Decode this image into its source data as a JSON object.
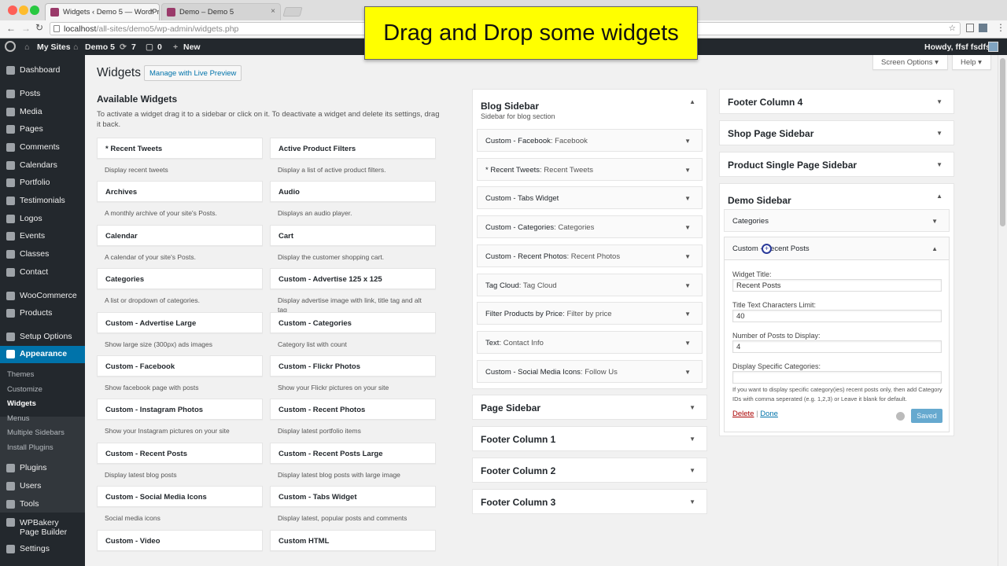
{
  "browser": {
    "tabs": [
      {
        "label": "Widgets ‹ Demo 5 — WordPre…",
        "close": "×"
      },
      {
        "label": "Demo – Demo 5",
        "close": "×"
      }
    ],
    "url_prefix": "localhost",
    "url_path": "/all-sites/demo5/wp-admin/widgets.php",
    "traffic_lights": [
      "#fe5f57",
      "#febc2e",
      "#28c840"
    ]
  },
  "adminbar": {
    "my_sites": "My Sites",
    "site": "Demo 5",
    "updates": "7",
    "comments": "0",
    "new": "New",
    "howdy": "Howdy, ffsf fsdfsd"
  },
  "menu": {
    "items": [
      {
        "label": "Dashboard",
        "icon": "dashboard-icon"
      },
      {
        "label": "Posts",
        "icon": "pin-icon"
      },
      {
        "label": "Media",
        "icon": "media-icon"
      },
      {
        "label": "Pages",
        "icon": "pages-icon"
      },
      {
        "label": "Comments",
        "icon": "comments-icon"
      },
      {
        "label": "Calendars",
        "icon": "calendar-icon"
      },
      {
        "label": "Portfolio",
        "icon": "pin-icon"
      },
      {
        "label": "Testimonials",
        "icon": "pin-icon"
      },
      {
        "label": "Logos",
        "icon": "pin-icon"
      },
      {
        "label": "Events",
        "icon": "pin-icon"
      },
      {
        "label": "Classes",
        "icon": "pin-icon"
      },
      {
        "label": "Contact",
        "icon": "mail-icon"
      },
      {
        "label": "WooCommerce",
        "icon": "woocommerce-icon"
      },
      {
        "label": "Products",
        "icon": "products-icon"
      },
      {
        "label": "Setup Options",
        "icon": "gear-icon"
      },
      {
        "label": "Appearance",
        "icon": "brush-icon"
      }
    ],
    "sub": [
      "Themes",
      "Customize",
      "Widgets",
      "Menus",
      "Multiple Sidebars",
      "Install Plugins"
    ],
    "after": [
      {
        "label": "Plugins",
        "icon": "plugin-icon"
      },
      {
        "label": "Users",
        "icon": "users-icon"
      },
      {
        "label": "Tools",
        "icon": "tools-icon"
      },
      {
        "label": "WPBakery Page Builder",
        "icon": "wpbakery-icon"
      },
      {
        "label": "Settings",
        "icon": "settings-icon"
      }
    ],
    "accent": "#0073aa"
  },
  "page": {
    "screen_options": "Screen Options ▾",
    "help": "Help ▾",
    "title": "Widgets",
    "live_preview": "Manage with Live Preview",
    "available_title": "Available Widgets",
    "available_desc": "To activate a widget drag it to a sidebar or click on it. To deactivate a widget and delete its settings, drag it back."
  },
  "widgets": [
    {
      "name": "* Recent Tweets",
      "desc": "Display recent tweets"
    },
    {
      "name": "Active Product Filters",
      "desc": "Display a list of active product filters."
    },
    {
      "name": "Archives",
      "desc": "A monthly archive of your site's Posts."
    },
    {
      "name": "Audio",
      "desc": "Displays an audio player."
    },
    {
      "name": "Calendar",
      "desc": "A calendar of your site's Posts."
    },
    {
      "name": "Cart",
      "desc": "Display the customer shopping cart."
    },
    {
      "name": "Categories",
      "desc": "A list or dropdown of categories."
    },
    {
      "name": "Custom - Advertise 125 x 125",
      "desc": "Display advertise image with link, title tag and alt tag"
    },
    {
      "name": "Custom - Advertise Large",
      "desc": "Show large size (300px) ads images"
    },
    {
      "name": "Custom - Categories",
      "desc": "Category list with count"
    },
    {
      "name": "Custom - Facebook",
      "desc": "Show facebook page with posts"
    },
    {
      "name": "Custom - Flickr Photos",
      "desc": "Show your Flickr pictures on your site"
    },
    {
      "name": "Custom - Instagram Photos",
      "desc": "Show your Instagram pictures on your site"
    },
    {
      "name": "Custom - Recent Photos",
      "desc": "Display latest portfolio items"
    },
    {
      "name": "Custom - Recent Posts",
      "desc": "Display latest blog posts"
    },
    {
      "name": "Custom - Recent Posts Large",
      "desc": "Display latest blog posts with large image"
    },
    {
      "name": "Custom - Social Media Icons",
      "desc": "Social media icons"
    },
    {
      "name": "Custom - Tabs Widget",
      "desc": "Display latest, popular posts and comments"
    },
    {
      "name": "Custom - Video",
      "desc": ""
    },
    {
      "name": "Custom HTML",
      "desc": ""
    }
  ],
  "blog_sidebar": {
    "title": "Blog Sidebar",
    "desc": "Sidebar for blog section",
    "items": [
      {
        "name": "Custom - Facebook",
        "title": ": Facebook"
      },
      {
        "name": "* Recent Tweets",
        "title": ": Recent Tweets"
      },
      {
        "name": "Custom - Tabs Widget",
        "title": ""
      },
      {
        "name": "Custom - Categories",
        "title": ": Categories"
      },
      {
        "name": "Custom - Recent Photos",
        "title": ": Recent Photos"
      },
      {
        "name": "Tag Cloud",
        "title": ": Tag Cloud"
      },
      {
        "name": "Filter Products by Price",
        "title": ": Filter by price"
      },
      {
        "name": "Text",
        "title": ": Contact Info"
      },
      {
        "name": "Custom - Social Media Icons",
        "title": ": Follow Us"
      }
    ]
  },
  "middle_sidebars": [
    "Page Sidebar",
    "Footer Column 1",
    "Footer Column 2",
    "Footer Column 3"
  ],
  "right_sidebars": [
    "Footer Column 4",
    "Shop Page Sidebar",
    "Product Single Page Sidebar"
  ],
  "demo_sidebar": {
    "title": "Demo Sidebar",
    "categories": "Categories",
    "widget": "Custom - Recent Posts",
    "form": {
      "title_label": "Widget Title:",
      "title_value": "Recent Posts",
      "limit_label": "Title Text Characters Limit:",
      "limit_value": "40",
      "count_label": "Number of Posts to Display:",
      "count_value": "4",
      "cats_label": "Display Specific Categories:",
      "cats_value": "",
      "help": "If you want to display specific category(ies) recent posts only, then add Category IDs with comma seperated (e.g. 1,2,3) or Leave it blank for default.",
      "delete": "Delete",
      "sep": "|",
      "done": "Done",
      "saved": "Saved"
    }
  },
  "overlay": {
    "text": "Drag and Drop some widgets",
    "color": "#ffff00"
  }
}
